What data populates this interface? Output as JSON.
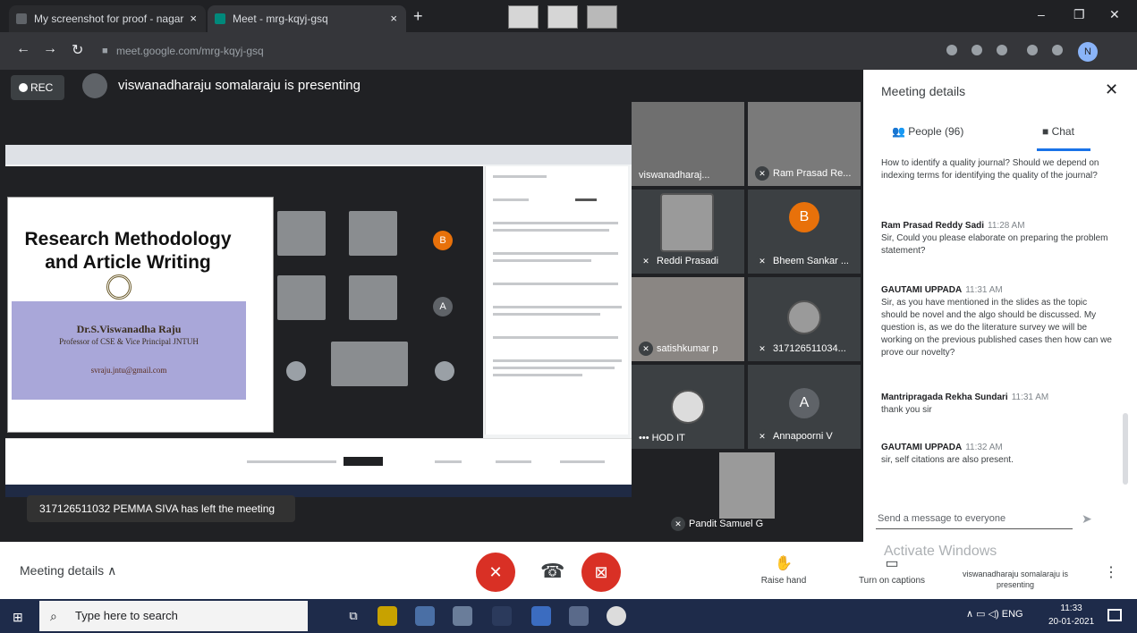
{
  "browser": {
    "tabs": [
      {
        "title": "My screenshot for proof - nagar"
      },
      {
        "title": "Meet - mrg-kqyj-gsq"
      }
    ],
    "new_tab_label": "+",
    "close_label": "×",
    "url": "meet.google.com/mrg-kqyj-gsq",
    "profile_initial": "N",
    "window_minimize": "–",
    "window_restore": "❐",
    "window_close": "✕"
  },
  "meet": {
    "rec_label": "REC",
    "presenting_text": "viswanadharaju somalaraju is presenting",
    "slide": {
      "title": "Research Methodology and Article Writing",
      "name": "Dr.S.Viswanadha Raju",
      "role": "Professor of CSE & Vice Principal JNTUH",
      "email": "svraju.jntu@gmail.com"
    },
    "toast": "317126511032 PEMMA SIVA has left the meeting",
    "participants": [
      {
        "name": "viswanadharaj...",
        "muted": false
      },
      {
        "name": "Ram Prasad Re...",
        "muted": true
      },
      {
        "name": "Reddi Prasadi",
        "muted": true
      },
      {
        "name": "Bheem Sankar ...",
        "muted": true,
        "initial": "B",
        "color": "#e8710a"
      },
      {
        "name": "satishkumar p",
        "muted": true
      },
      {
        "name": "317126511034...",
        "muted": true
      },
      {
        "name": "HOD IT",
        "muted": false
      },
      {
        "name": "Annapoorni V",
        "muted": true,
        "initial": "A",
        "color": "#e8710a"
      },
      {
        "name": "Pandit Samuel G",
        "muted": true
      }
    ]
  },
  "panel": {
    "title": "Meeting details",
    "tab_people": "People (96)",
    "tab_chat": "Chat",
    "messages": [
      {
        "sender": "",
        "time": "",
        "text": "How to identify a quality journal? Should we depend on indexing terms for identifying the quality of the journal?"
      },
      {
        "sender": "Ram Prasad Reddy Sadi",
        "time": "11:28 AM",
        "text": "Sir, Could you please elaborate on preparing the problem statement?"
      },
      {
        "sender": "GAUTAMI UPPADA",
        "time": "11:31 AM",
        "text": "Sir, as you have mentioned in the slides as the topic should be novel and the algo should be discussed. My question is, as we do the literature survey we will be working on the previous published cases then how can we prove our novelty?"
      },
      {
        "sender": "Mantripragada Rekha Sundari",
        "time": "11:31 AM",
        "text": "thank you sir"
      },
      {
        "sender": "GAUTAMI UPPADA",
        "time": "11:32 AM",
        "text": "sir, self citations are also present."
      }
    ],
    "input_placeholder": "Send a message to everyone"
  },
  "controls": {
    "meeting_details": "Meeting details",
    "raise_hand": "Raise hand",
    "captions": "Turn on captions",
    "you_presenting": "viswanadharaju somalaraju is presenting",
    "watermark": "Activate Windows",
    "more": "⋮"
  },
  "taskbar": {
    "search_placeholder": "Type here to search",
    "tray_lang": "ENG",
    "time": "11:33",
    "date": "20-01-2021"
  },
  "colors": {
    "meet_dark": "#202124",
    "tile": "#3c4043",
    "danger": "#d93025",
    "accent": "#1a73e8",
    "taskbar": "#1e2b4a"
  }
}
